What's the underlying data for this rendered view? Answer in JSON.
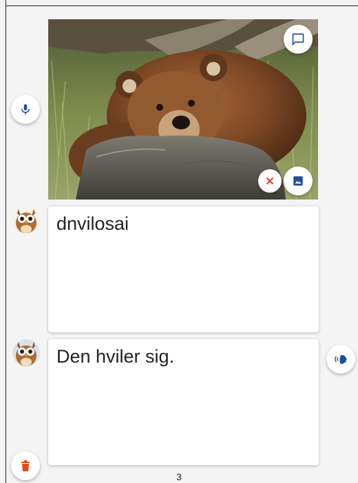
{
  "cards": [
    {
      "text": "dnvilosai"
    },
    {
      "text": "Den hviler sig."
    }
  ],
  "page_number": "3",
  "icons": {
    "mic": "microphone-icon",
    "comment": "comment-icon",
    "close": "close-icon",
    "image": "image-icon",
    "speak": "speak-icon",
    "delete": "trash-icon",
    "avatar": "owl-avatar"
  },
  "colors": {
    "accent": "#1e4f9c",
    "close": "#e53935",
    "delete": "#e64a19"
  }
}
